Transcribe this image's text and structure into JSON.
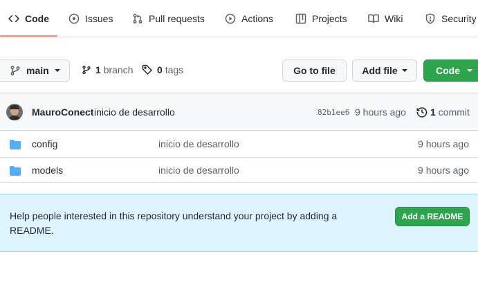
{
  "tabs": [
    {
      "label": "Code",
      "icon": "code-icon",
      "active": true
    },
    {
      "label": "Issues",
      "icon": "issue-opened-icon"
    },
    {
      "label": "Pull requests",
      "icon": "git-pull-request-icon"
    },
    {
      "label": "Actions",
      "icon": "play-icon"
    },
    {
      "label": "Projects",
      "icon": "table-icon"
    },
    {
      "label": "Wiki",
      "icon": "book-icon"
    },
    {
      "label": "Security",
      "icon": "shield-icon"
    }
  ],
  "branch_bar": {
    "branch_name": "main",
    "branch_count": "1",
    "branch_label": "branch",
    "tag_count": "0",
    "tag_label": "tags",
    "go_to_file": "Go to file",
    "add_file": "Add file",
    "code_button": "Code"
  },
  "commit": {
    "author": "MauroConect",
    "message": "inicio de desarrollo",
    "sha": "82b1ee6",
    "time": "9 hours ago",
    "count": "1",
    "count_label": "commit"
  },
  "files": [
    {
      "name": "config",
      "message": "inicio de desarrollo",
      "time": "9 hours ago",
      "type": "folder"
    },
    {
      "name": "models",
      "message": "inicio de desarrollo",
      "time": "9 hours ago",
      "type": "folder"
    }
  ],
  "readme": {
    "text": "Help people interested in this repository understand your project by adding a README.",
    "button": "Add a README"
  },
  "colors": {
    "accent_underline": "#fd8c73",
    "primary_green": "#2da44e",
    "folder_blue": "#54aeff",
    "banner_bg": "#ddf4ff"
  }
}
